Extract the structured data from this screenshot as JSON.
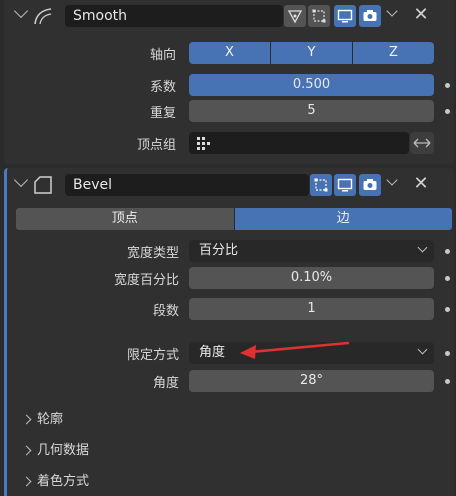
{
  "smooth": {
    "name": "Smooth",
    "axis_label": "轴向",
    "axes": [
      "X",
      "Y",
      "Z"
    ],
    "factor_label": "系数",
    "factor_value": "0.500",
    "factor_fraction": 0.5,
    "repeat_label": "重复",
    "repeat_value": "5",
    "vgroup_label": "顶点组"
  },
  "bevel": {
    "name": "Bevel",
    "tabs": [
      {
        "label": "顶点",
        "active": false
      },
      {
        "label": "边",
        "active": true
      }
    ],
    "width_type_label": "宽度类型",
    "width_type_value": "百分比",
    "width_percent_label": "宽度百分比",
    "width_percent_value": "0.10%",
    "segments_label": "段数",
    "segments_value": "1",
    "limit_label": "限定方式",
    "limit_value": "角度",
    "angle_label": "角度",
    "angle_value": "28°",
    "subpanels": [
      "轮廓",
      "几何数据",
      "着色方式"
    ]
  },
  "colors": {
    "accent": "#4772b3",
    "arrow": "#e03030"
  }
}
